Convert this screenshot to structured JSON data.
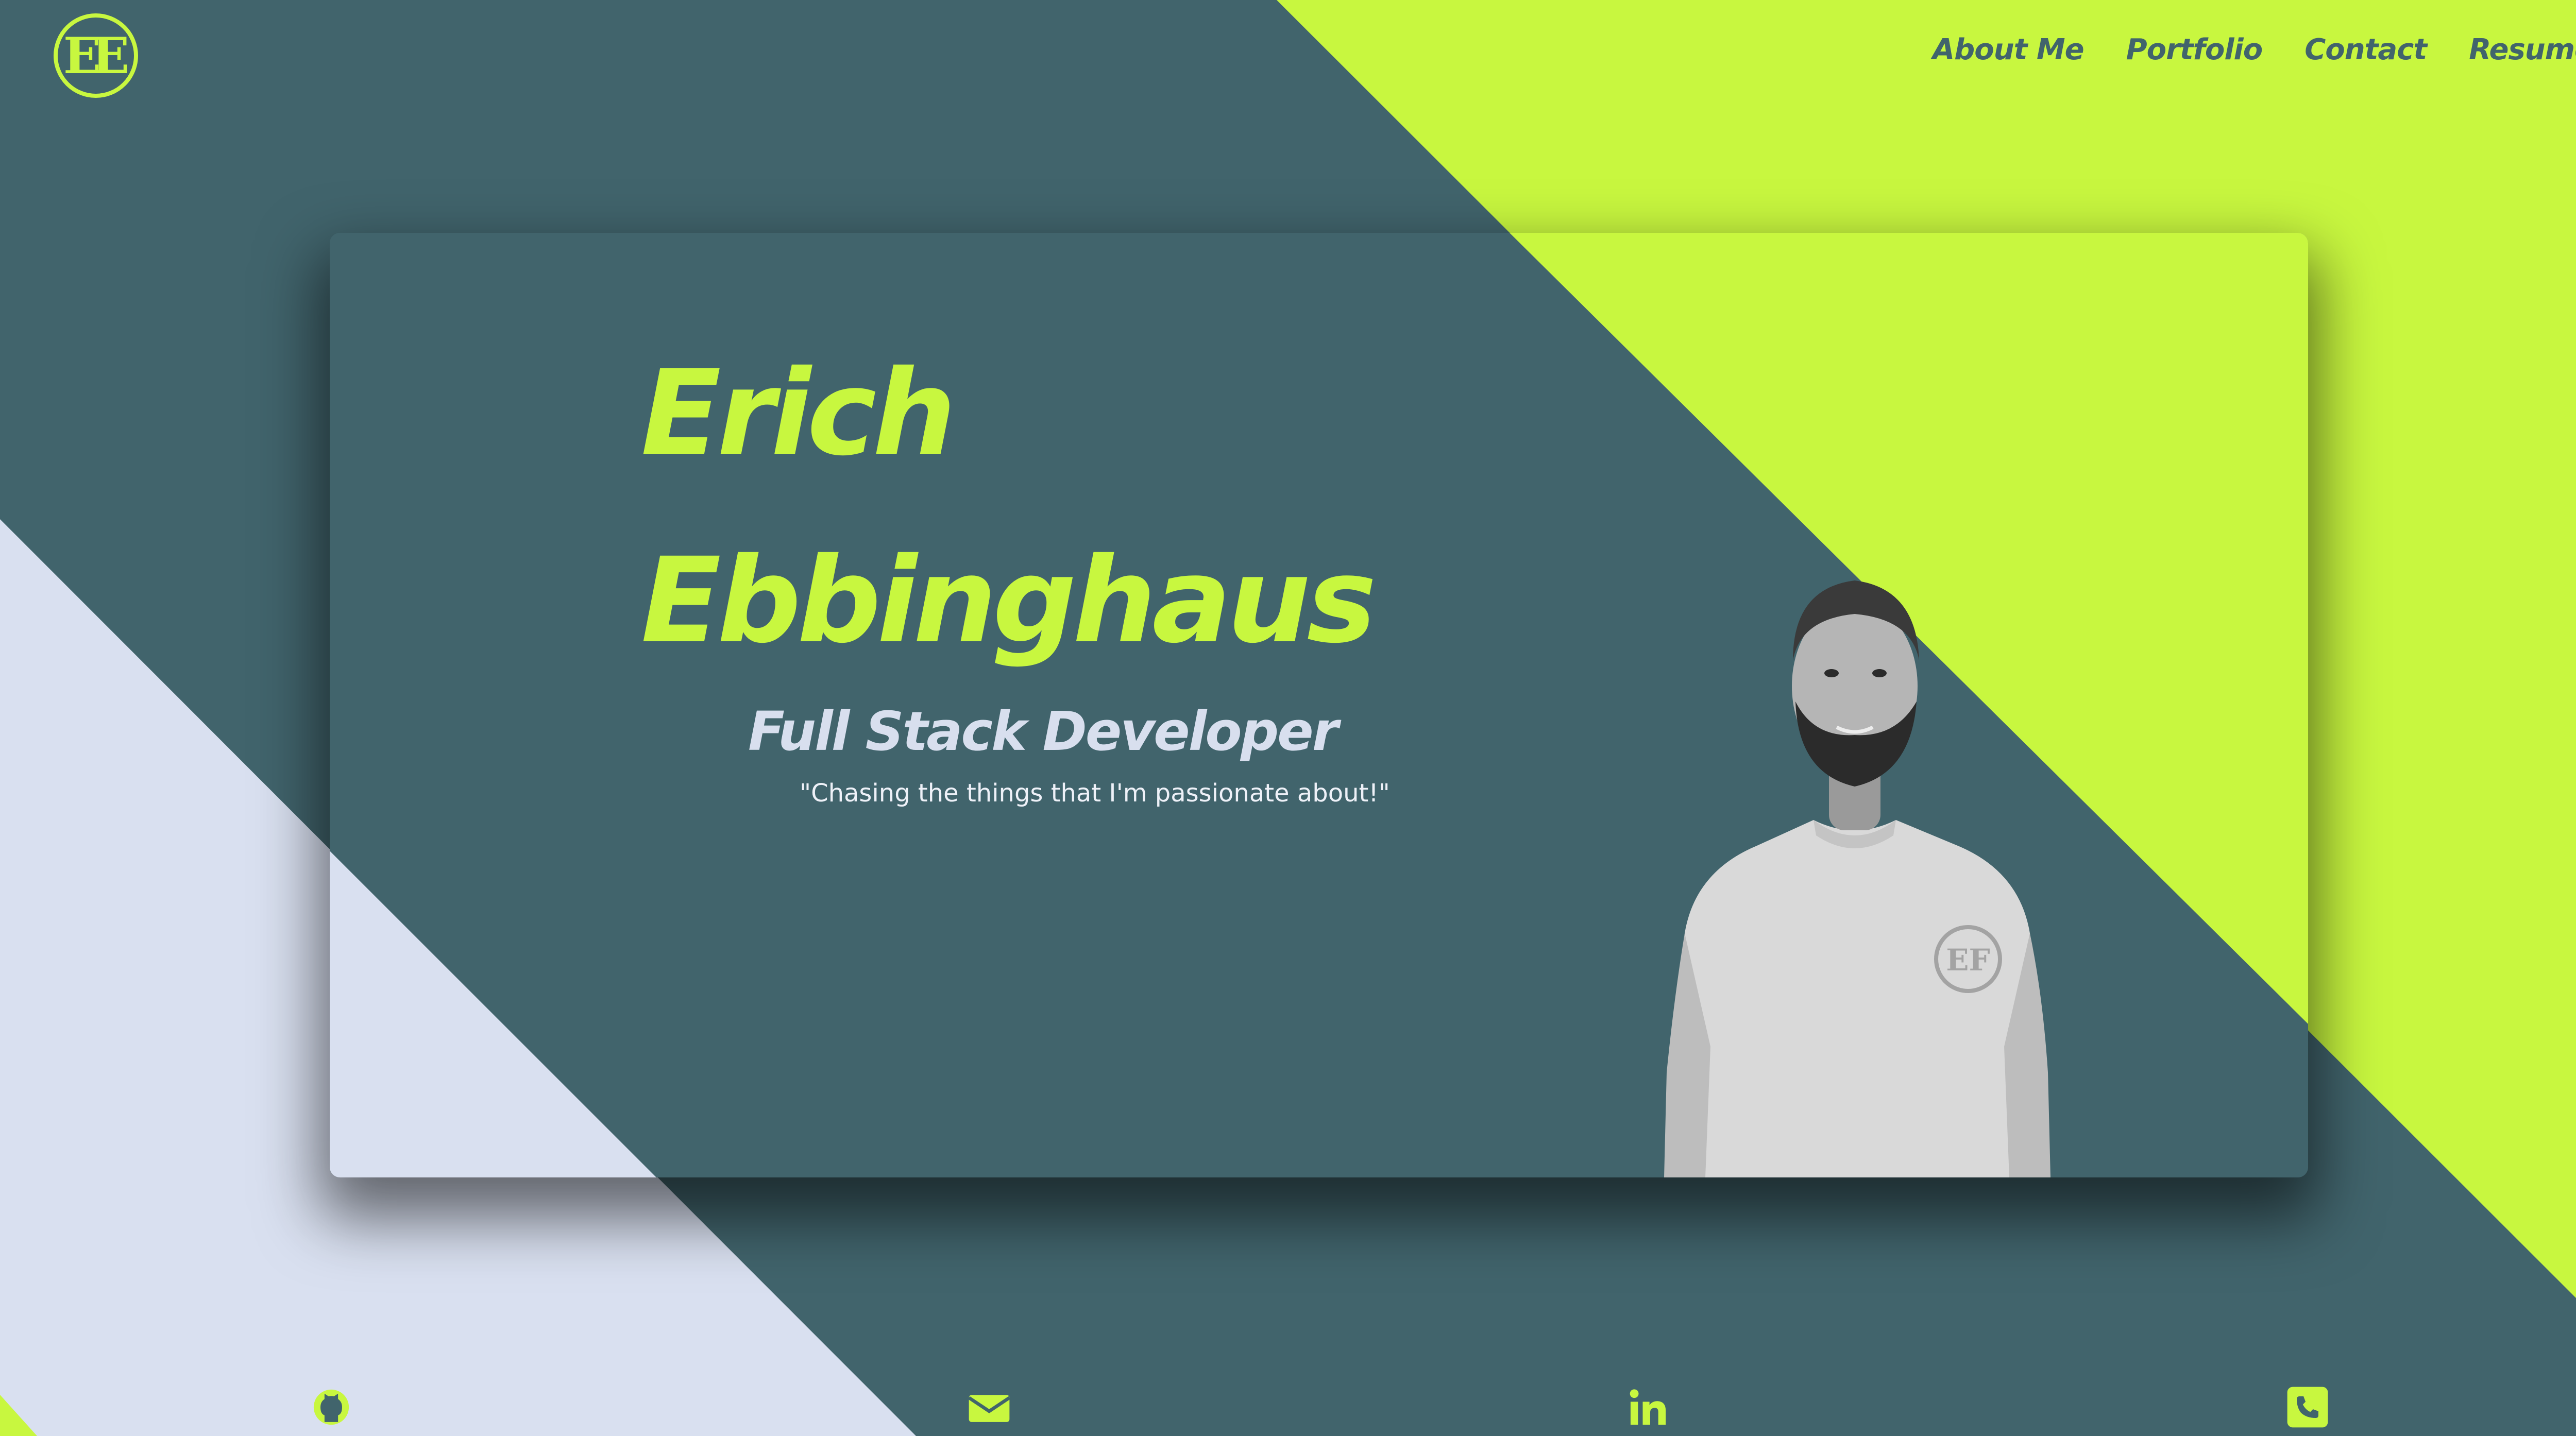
{
  "logo": {
    "text": "EE"
  },
  "nav": {
    "items": [
      {
        "label": "About Me"
      },
      {
        "label": "Portfolio"
      },
      {
        "label": "Contact"
      },
      {
        "label": "Resume"
      }
    ]
  },
  "hero": {
    "first_name": "Erich",
    "last_name": "Ebbinghaus",
    "title": "Full Stack Developer",
    "tagline": "\"Chasing the things that I'm passionate about!\"",
    "photo_badge": "EF"
  },
  "social": [
    {
      "icon": "github-icon"
    },
    {
      "icon": "envelope-icon"
    },
    {
      "icon": "linkedin-icon"
    },
    {
      "icon": "phone-icon"
    }
  ],
  "colors": {
    "teal": "#41646c",
    "lime": "#c8f73f",
    "lavender": "#d9e0f0"
  }
}
